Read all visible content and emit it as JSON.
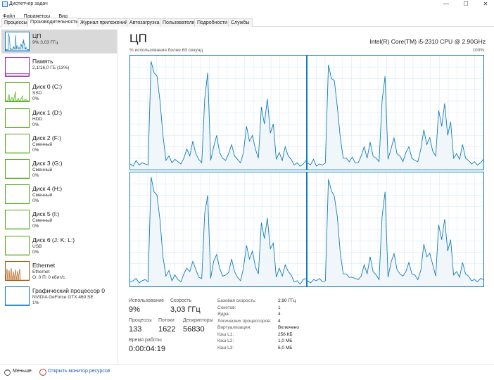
{
  "window": {
    "title": "Диспетчер задач",
    "minimize": "—",
    "maximize": "☐",
    "close": "✕"
  },
  "menu": [
    "Файл",
    "Параметры",
    "Вид"
  ],
  "tabs": [
    "Процессы",
    "Производительность",
    "Журнал приложений",
    "Автозагрузка",
    "Пользователи",
    "Подробности",
    "Службы"
  ],
  "active_tab": "Производительность",
  "sidebar": [
    {
      "name": "ЦП",
      "sub1": "9%  3,03 ГГц",
      "sub2": "",
      "color": "#117dbb",
      "icon": "cpu-graph-thumb",
      "selected": true
    },
    {
      "name": "Память",
      "sub1": "2,1/16,0 ГБ (13%)",
      "sub2": "",
      "color": "#8b1fa6",
      "icon": "memory-graph-thumb",
      "selected": false
    },
    {
      "name": "Диск 0 (C:)",
      "sub1": "SSD",
      "sub2": "0%",
      "color": "#4da60c",
      "icon": "disk-graph-thumb",
      "selected": false
    },
    {
      "name": "Диск 1 (D:)",
      "sub1": "HDD",
      "sub2": "0%",
      "color": "#4da60c",
      "icon": "disk-graph-thumb",
      "selected": false
    },
    {
      "name": "Диск 2 (F:)",
      "sub1": "Сменный",
      "sub2": "0%",
      "color": "#4da60c",
      "icon": "disk-graph-thumb",
      "selected": false
    },
    {
      "name": "Диск 3 (G:)",
      "sub1": "Сменный",
      "sub2": "0%",
      "color": "#4da60c",
      "icon": "disk-graph-thumb",
      "selected": false
    },
    {
      "name": "Диск 4 (H:)",
      "sub1": "Сменный",
      "sub2": "0%",
      "color": "#4da60c",
      "icon": "disk-graph-thumb",
      "selected": false
    },
    {
      "name": "Диск 5 (I:)",
      "sub1": "Сменный",
      "sub2": "0%",
      "color": "#4da60c",
      "icon": "disk-graph-thumb",
      "selected": false
    },
    {
      "name": "Диск 6 (J: K: L:)",
      "sub1": "USB",
      "sub2": "0%",
      "color": "#4da60c",
      "icon": "disk-graph-thumb",
      "selected": false
    },
    {
      "name": "Ethernet",
      "sub1": "Ethernet",
      "sub2": "О: 0  П: 0 кбит/с",
      "color": "#a74f01",
      "icon": "ethernet-graph-thumb",
      "selected": false
    },
    {
      "name": "Графический процессор 0",
      "sub1": "NVIDIA GeForce GTX 460 SE",
      "sub2": "1%",
      "color": "#117dbb",
      "icon": "gpu-graph-thumb",
      "selected": false
    }
  ],
  "main": {
    "title": "ЦП",
    "model": "Intel(R) Core(TM) i5-2310 CPU @ 2.90GHz",
    "graph_caption": "% использования более 60 секунд",
    "graph_max": "100%",
    "graph_color": "#117dbb",
    "stats": {
      "usage_label": "Использование",
      "usage_value": "9%",
      "speed_label": "Скорость",
      "speed_value": "3,03 ГГц",
      "processes_label": "Процессы",
      "processes_value": "133",
      "threads_label": "Потоки",
      "threads_value": "1622",
      "handles_label": "Дескрипторы",
      "handles_value": "56830",
      "uptime_label": "Время работы",
      "uptime_value": "0:00:04:19"
    },
    "specs": [
      {
        "label": "Базовая скорость:",
        "value": "2,90 ГГц"
      },
      {
        "label": "Сокетов:",
        "value": "1"
      },
      {
        "label": "Ядра:",
        "value": "4"
      },
      {
        "label": "Логических процессоров:",
        "value": "4"
      },
      {
        "label": "Виртуализация:",
        "value": "Включено"
      },
      {
        "label": "Кэш L1:",
        "value": "256 КБ"
      },
      {
        "label": "Кэш L2:",
        "value": "1,0 МБ"
      },
      {
        "label": "Кэш L3:",
        "value": "6,0 МБ"
      }
    ]
  },
  "footer": {
    "less_label": "Меньше",
    "monitor_link": "Открыть монитор ресурсов"
  },
  "cpu_core_usage": [
    [
      5,
      3,
      8,
      4,
      6,
      5,
      4,
      95,
      85,
      82,
      60,
      30,
      8,
      12,
      6,
      9,
      7,
      5,
      10,
      18,
      12,
      25,
      14,
      9,
      6,
      62,
      85,
      8,
      20,
      30,
      15,
      10,
      8,
      14,
      22,
      12,
      9,
      6,
      15,
      38,
      25,
      30,
      18,
      10,
      55,
      40,
      62,
      32,
      40,
      9,
      15,
      8,
      20,
      12,
      9,
      4,
      6,
      3,
      5,
      8
    ],
    [
      6,
      4,
      9,
      3,
      5,
      4,
      6,
      92,
      80,
      78,
      55,
      28,
      10,
      10,
      7,
      11,
      6,
      6,
      12,
      20,
      10,
      24,
      12,
      10,
      7,
      60,
      82,
      9,
      18,
      28,
      14,
      12,
      7,
      15,
      20,
      10,
      8,
      7,
      18,
      35,
      22,
      28,
      16,
      12,
      52,
      38,
      58,
      30,
      42,
      10,
      14,
      9,
      22,
      10,
      8,
      5,
      7,
      4,
      6,
      9
    ],
    [
      4,
      5,
      7,
      3,
      5,
      6,
      4,
      96,
      83,
      80,
      58,
      26,
      9,
      14,
      5,
      10,
      6,
      4,
      11,
      16,
      13,
      22,
      15,
      8,
      7,
      64,
      80,
      7,
      22,
      28,
      16,
      9,
      10,
      12,
      24,
      13,
      8,
      5,
      16,
      36,
      24,
      31,
      17,
      11,
      56,
      42,
      60,
      33,
      38,
      8,
      16,
      9,
      19,
      13,
      10,
      4,
      5,
      2,
      6,
      7
    ],
    [
      5,
      3,
      6,
      5,
      7,
      4,
      5,
      94,
      84,
      79,
      61,
      29,
      11,
      11,
      8,
      8,
      7,
      6,
      9,
      19,
      11,
      26,
      13,
      10,
      6,
      61,
      83,
      8,
      21,
      29,
      15,
      11,
      9,
      13,
      21,
      11,
      10,
      6,
      14,
      37,
      26,
      29,
      19,
      9,
      54,
      41,
      59,
      31,
      41,
      10,
      13,
      8,
      21,
      11,
      9,
      5,
      6,
      4,
      7,
      6
    ]
  ]
}
